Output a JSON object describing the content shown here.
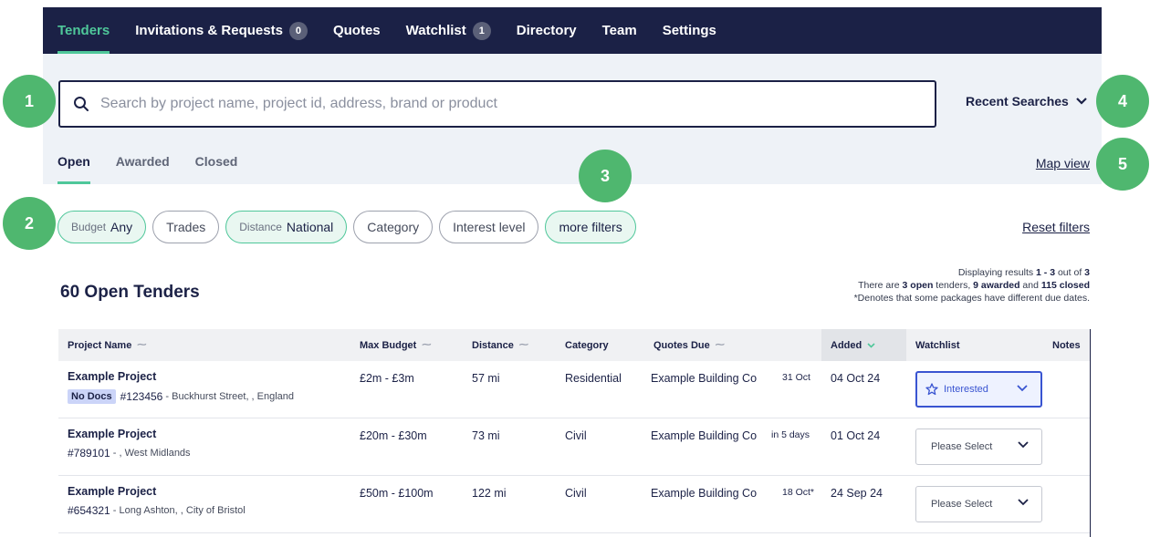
{
  "nav": {
    "items": [
      {
        "label": "Tenders",
        "active": true
      },
      {
        "label": "Invitations & Requests",
        "badge": "0"
      },
      {
        "label": "Quotes"
      },
      {
        "label": "Watchlist",
        "badge": "1"
      },
      {
        "label": "Directory"
      },
      {
        "label": "Team"
      },
      {
        "label": "Settings"
      }
    ]
  },
  "search": {
    "placeholder": "Search by project name, project id, address, brand or product",
    "recent_label": "Recent Searches"
  },
  "tabs": [
    {
      "label": "Open",
      "active": true
    },
    {
      "label": "Awarded"
    },
    {
      "label": "Closed"
    }
  ],
  "map_view_label": "Map view",
  "filters": {
    "budget": {
      "key": "Budget",
      "value": "Any"
    },
    "trades": "Trades",
    "distance": {
      "key": "Distance",
      "value": "National"
    },
    "category": "Category",
    "interest": "Interest level",
    "more": "more filters",
    "reset": "Reset filters"
  },
  "results": {
    "title": "60 Open Tenders",
    "line1_prefix": "Displaying results ",
    "line1_range": "1 - 3",
    "line1_mid": " out of ",
    "line1_total": "3",
    "line2_a": "There are ",
    "line2_open": "3 open",
    "line2_b": " tenders, ",
    "line2_awarded": "9 awarded",
    "line2_c": " and ",
    "line2_closed": "115 closed",
    "line3": "*Denotes that some packages have different due dates."
  },
  "table": {
    "headers": {
      "project": "Project Name",
      "budget": "Max Budget",
      "distance": "Distance",
      "category": "Category",
      "quotes_due": "Quotes Due",
      "added": "Added",
      "watchlist": "Watchlist",
      "notes": "Notes"
    },
    "rows": [
      {
        "name": "Example Project",
        "no_docs": "No Docs",
        "id": "#123456",
        "address": "- Buckhurst Street, , England",
        "budget": "£2m - £3m",
        "distance": "57 mi",
        "category": "Residential",
        "company": "Example Building Co",
        "due": "31 Oct",
        "added": "04 Oct 24",
        "watch": "Interested"
      },
      {
        "name": "Example Project",
        "id": "#789101",
        "address": "- , West Midlands",
        "budget": "£20m - £30m",
        "distance": "73 mi",
        "category": "Civil",
        "company": "Example Building Co",
        "due": "in 5 days",
        "added": "01 Oct 24",
        "watch": "Please Select"
      },
      {
        "name": "Example Project",
        "id": "#654321",
        "address": "- Long Ashton, , City of Bristol",
        "budget": "£50m - £100m",
        "distance": "122 mi",
        "category": "Civil",
        "company": "Example Building Co",
        "due": "18 Oct*",
        "added": "24 Sep 24",
        "watch": "Please Select"
      }
    ]
  },
  "markers": [
    "1",
    "2",
    "3",
    "4",
    "5"
  ],
  "colors": {
    "nav_bg": "#1b2146",
    "accent": "#4fc79a",
    "marker": "#4fb76f",
    "select_active": "#3954d1"
  }
}
